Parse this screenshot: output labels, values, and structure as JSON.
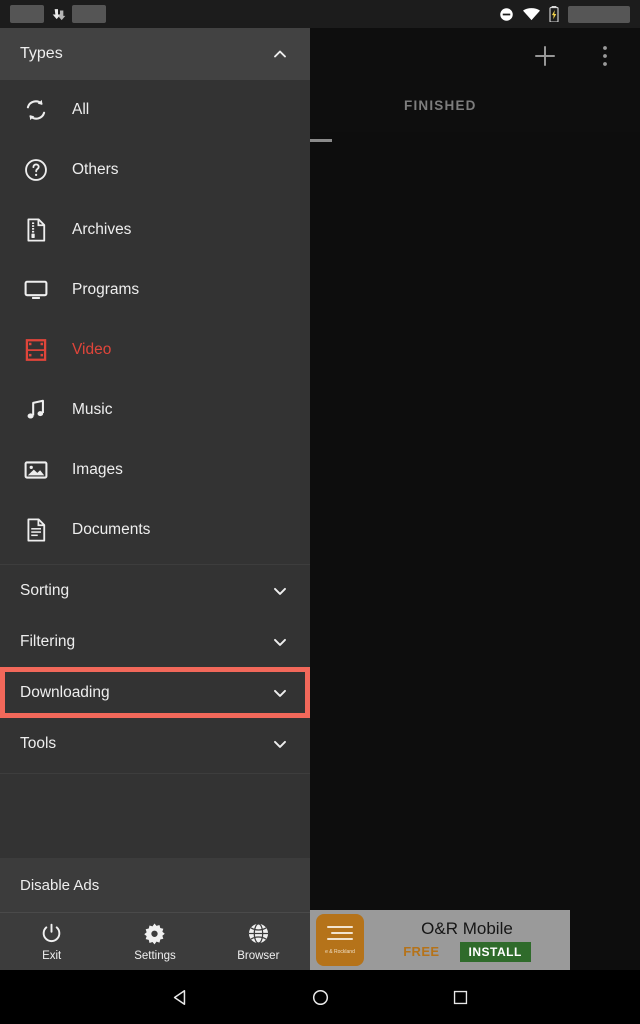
{
  "statusbar": {
    "left_icons": [
      "placeholder-block",
      "download-icon",
      "placeholder-block"
    ],
    "right_icons": [
      "do-not-disturb-icon",
      "wifi-icon",
      "battery-charging-icon"
    ],
    "clock": ""
  },
  "toolbar": {
    "add_label": "+",
    "add_icon": "plus-icon",
    "overflow_icon": "more-vertical-icon"
  },
  "tabs": [
    {
      "label": "FINISHED",
      "selected": false
    }
  ],
  "drawer": {
    "header": {
      "title": "Types",
      "chevron": "chevron-up-icon",
      "expanded": true
    },
    "types": [
      {
        "label": "All",
        "icon": "sync-icon",
        "active": false
      },
      {
        "label": "Others",
        "icon": "question-circle-icon",
        "active": false
      },
      {
        "label": "Archives",
        "icon": "archive-zip-icon",
        "active": false
      },
      {
        "label": "Programs",
        "icon": "monitor-icon",
        "active": false
      },
      {
        "label": "Video",
        "icon": "film-icon",
        "active": true
      },
      {
        "label": "Music",
        "icon": "music-note-icon",
        "active": false
      },
      {
        "label": "Images",
        "icon": "image-icon",
        "active": false
      },
      {
        "label": "Documents",
        "icon": "document-icon",
        "active": false
      }
    ],
    "sections": [
      {
        "label": "Sorting",
        "chevron": "chevron-down-icon",
        "highlighted": false
      },
      {
        "label": "Filtering",
        "chevron": "chevron-down-icon",
        "highlighted": false
      },
      {
        "label": "Downloading",
        "chevron": "chevron-down-icon",
        "highlighted": true
      },
      {
        "label": "Tools",
        "chevron": "chevron-down-icon",
        "highlighted": false
      }
    ],
    "disable_ads": "Disable Ads"
  },
  "bottombar": [
    {
      "label": "Exit",
      "icon": "power-icon"
    },
    {
      "label": "Settings",
      "icon": "gear-icon"
    },
    {
      "label": "Browser",
      "icon": "globe-icon"
    }
  ],
  "ad": {
    "title": "O&R Mobile",
    "price": "FREE",
    "cta": "INSTALL",
    "icon_caption": "e & Rockland"
  },
  "navbar": [
    {
      "icon": "back-triangle-icon"
    },
    {
      "icon": "home-circle-icon"
    },
    {
      "icon": "recents-square-icon"
    }
  ],
  "colors": {
    "accent_red": "#e0453a",
    "highlight_box": "#f2685a",
    "drawer_bg": "#333333",
    "drawer_header_bg": "#424242",
    "content_bg": "#0d0d0d",
    "ad_green": "#2f6b2b",
    "ad_orange": "#b5731a"
  }
}
